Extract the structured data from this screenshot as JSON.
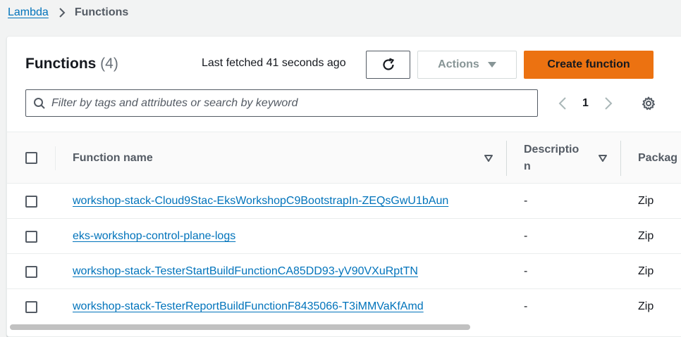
{
  "breadcrumb": {
    "parent": "Lambda",
    "current": "Functions"
  },
  "header": {
    "title": "Functions",
    "count": "(4)",
    "last_fetched": "Last fetched 41 seconds ago"
  },
  "toolbar": {
    "actions_label": "Actions",
    "create_label": "Create function"
  },
  "search": {
    "placeholder": "Filter by tags and attributes or search by keyword",
    "value": ""
  },
  "pagination": {
    "current_page": "1"
  },
  "table": {
    "columns": {
      "name": "Function name",
      "description_line1": "Descriptio",
      "description_line2": "n",
      "package": "Packag"
    },
    "rows": [
      {
        "name": "workshop-stack-Cloud9Stac-EksWorkshopC9BootstrapIn-ZEQsGwU1bAun",
        "description": "-",
        "package": "Zip"
      },
      {
        "name": "eks-workshop-control-plane-logs",
        "description": "-",
        "package": "Zip"
      },
      {
        "name": "workshop-stack-TesterStartBuildFunctionCA85DD93-yV90VXuRptTN",
        "description": "-",
        "package": "Zip"
      },
      {
        "name": "workshop-stack-TesterReportBuildFunctionF8435066-T3iMMVaKfAmd",
        "description": "-",
        "package": "Zip"
      }
    ]
  },
  "colors": {
    "link": "#0073bb",
    "primary_button": "#ec7211",
    "text": "#16191f",
    "muted": "#545b64"
  }
}
